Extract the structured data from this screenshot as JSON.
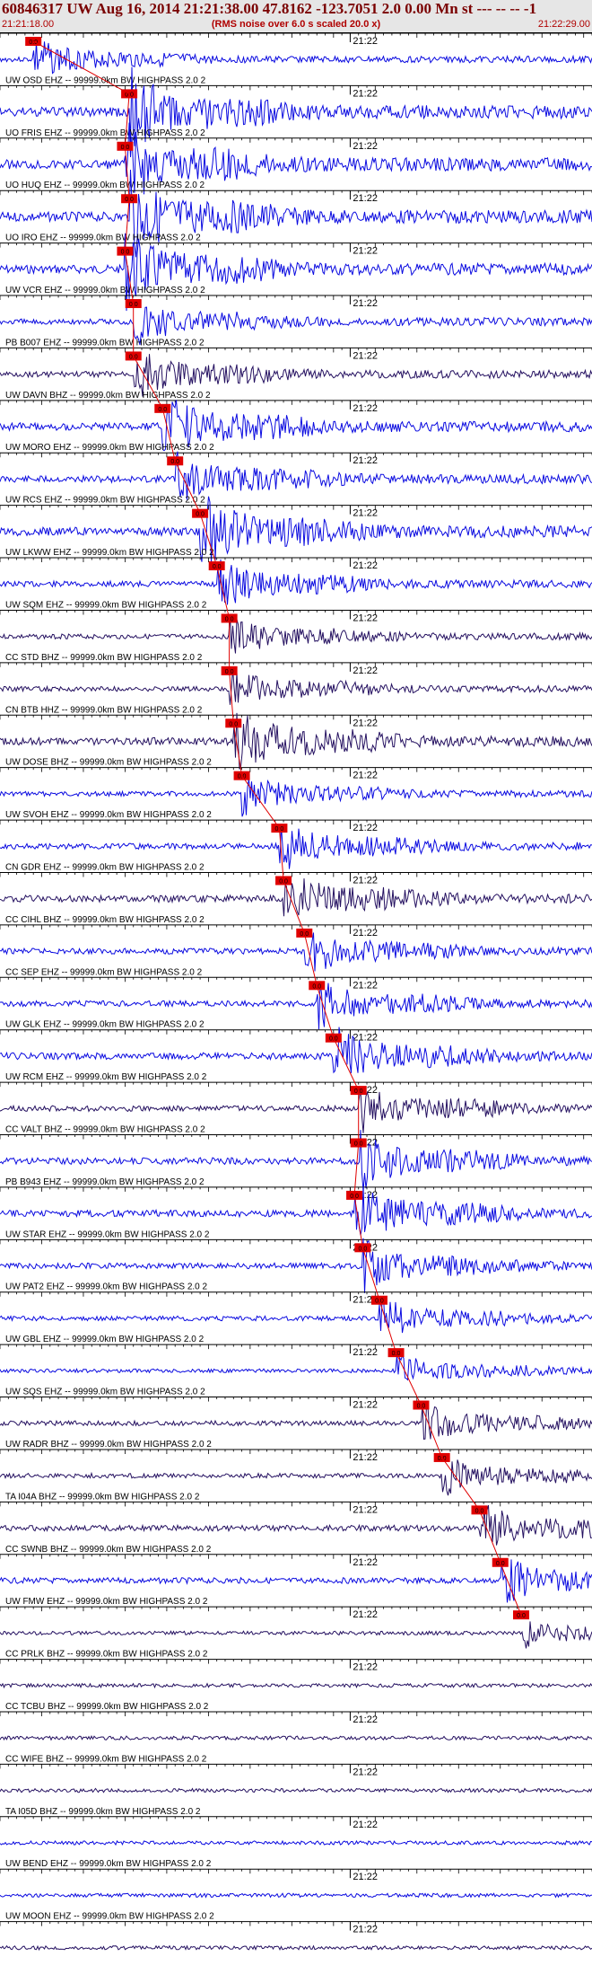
{
  "header": {
    "title": "60846317 UW Aug 16, 2014 21:21:38.00   47.8162 -123.7051  2.0 0.00 Mn st --- -- --   -1",
    "start_time": "21:21:18.00",
    "noise_note": "(RMS noise over 6.0 s scaled 20.0 x)",
    "end_time": "21:22:29.00"
  },
  "chart_data": {
    "type": "seismogram",
    "time_start": "21:21:18.00",
    "time_end": "21:22:29.00",
    "minute_label": "21:22",
    "minute_label_offset_s": 42,
    "pick_label": "0:0",
    "colors": {
      "trace_blue": "#0a0ae0",
      "trace_navy": "#241060",
      "pick": "#e00000",
      "text": "#000000"
    },
    "traces": [
      {
        "label": "UW OSD EHZ -- 99999.0km BW  HIGHPASS  2.0  2",
        "color": "blue",
        "pick_s": 4.0,
        "amp": 0.25
      },
      {
        "label": "UO FRIS EHZ -- 99999.0km BW  HIGHPASS  2.0  2",
        "color": "blue",
        "pick_s": 15.5,
        "amp": 0.5
      },
      {
        "label": "UO HUQ EHZ -- 99999.0km BW  HIGHPASS  2.0  2",
        "color": "blue",
        "pick_s": 15.0,
        "amp": 0.5
      },
      {
        "label": "UO IRO EHZ -- 99999.0km BW  HIGHPASS  2.0  2",
        "color": "blue",
        "pick_s": 15.5,
        "amp": 0.5
      },
      {
        "label": "UW VCR EHZ -- 99999.0km BW  HIGHPASS  2.0  2",
        "color": "blue",
        "pick_s": 15.0,
        "amp": 0.45
      },
      {
        "label": "PB B007 EHZ -- 99999.0km BW  HIGHPASS  2.0  2",
        "color": "blue",
        "pick_s": 16.0,
        "amp": 0.3
      },
      {
        "label": "UW DAVN BHZ -- 99999.0km BW  HIGHPASS  2.0  2",
        "color": "navy",
        "pick_s": 16.0,
        "amp": 0.3
      },
      {
        "label": "UW MORO EHZ -- 99999.0km BW  HIGHPASS  2.0  2",
        "color": "blue",
        "pick_s": 19.5,
        "amp": 0.4
      },
      {
        "label": "UW RCS EHZ -- 99999.0km BW  HIGHPASS  2.0  2",
        "color": "blue",
        "pick_s": 21.0,
        "amp": 0.35
      },
      {
        "label": "UW LKWW EHZ -- 99999.0km BW  HIGHPASS  2.0  2",
        "color": "blue",
        "pick_s": 24.0,
        "amp": 0.45
      },
      {
        "label": "UW SQM EHZ -- 99999.0km BW  HIGHPASS  2.0  2",
        "color": "blue",
        "pick_s": 26.0,
        "amp": 0.3
      },
      {
        "label": "CC STD BHZ -- 99999.0km BW  HIGHPASS  2.0  2",
        "color": "navy",
        "pick_s": 27.5,
        "amp": 0.25
      },
      {
        "label": "CN BTB HHZ -- 99999.0km BW  HIGHPASS  2.0  2",
        "color": "navy",
        "pick_s": 27.5,
        "amp": 0.25
      },
      {
        "label": "UW DOSE BHZ -- 99999.0km BW  HIGHPASS  2.0  2",
        "color": "navy",
        "pick_s": 28.0,
        "amp": 0.4
      },
      {
        "label": "UW SVOH EHZ -- 99999.0km BW  HIGHPASS  2.0  2",
        "color": "blue",
        "pick_s": 29.0,
        "amp": 0.25
      },
      {
        "label": "CN GDR EHZ -- 99999.0km BW  HIGHPASS  2.0  2",
        "color": "blue",
        "pick_s": 33.5,
        "amp": 0.3
      },
      {
        "label": "CC CIHL BHZ -- 99999.0km BW  HIGHPASS  2.0  2",
        "color": "navy",
        "pick_s": 34.0,
        "amp": 0.35
      },
      {
        "label": "CC SEP EHZ -- 99999.0km BW  HIGHPASS  2.0  2",
        "color": "blue",
        "pick_s": 36.5,
        "amp": 0.3
      },
      {
        "label": "UW GLK EHZ -- 99999.0km BW  HIGHPASS  2.0  2",
        "color": "blue",
        "pick_s": 38.0,
        "amp": 0.3
      },
      {
        "label": "UW RCM EHZ -- 99999.0km BW  HIGHPASS  2.0  2",
        "color": "blue",
        "pick_s": 40.0,
        "amp": 0.35
      },
      {
        "label": "CC VALT BHZ -- 99999.0km BW  HIGHPASS  2.0  2",
        "color": "navy",
        "pick_s": 43.0,
        "amp": 0.3
      },
      {
        "label": "PB B943 EHZ -- 99999.0km BW  HIGHPASS  2.0  2",
        "color": "blue",
        "pick_s": 43.0,
        "amp": 0.35
      },
      {
        "label": "UW STAR EHZ -- 99999.0km BW  HIGHPASS  2.0  2",
        "color": "blue",
        "pick_s": 42.5,
        "amp": 0.35
      },
      {
        "label": "UW PAT2 EHZ -- 99999.0km BW  HIGHPASS  2.0  2",
        "color": "blue",
        "pick_s": 43.5,
        "amp": 0.3
      },
      {
        "label": "UW GBL EHZ -- 99999.0km BW  HIGHPASS  2.0  2",
        "color": "blue",
        "pick_s": 45.5,
        "amp": 0.25
      },
      {
        "label": "UW SQS EHZ -- 99999.0km BW  HIGHPASS  2.0  2",
        "color": "blue",
        "pick_s": 47.5,
        "amp": 0.2
      },
      {
        "label": "UW RADR BHZ -- 99999.0km BW  HIGHPASS  2.0  2",
        "color": "navy",
        "pick_s": 50.5,
        "amp": 0.25
      },
      {
        "label": "TA I04A BHZ -- 99999.0km BW  HIGHPASS  2.0  2",
        "color": "navy",
        "pick_s": 53.0,
        "amp": 0.25
      },
      {
        "label": "CC SWNB BHZ -- 99999.0km BW  HIGHPASS  2.0  2",
        "color": "navy",
        "pick_s": 57.5,
        "amp": 0.3
      },
      {
        "label": "UW FMW EHZ -- 99999.0km BW  HIGHPASS  2.0  2",
        "color": "blue",
        "pick_s": 60.0,
        "amp": 0.3
      },
      {
        "label": "CC PRLK BHZ -- 99999.0km BW  HIGHPASS  2.0  2",
        "color": "navy",
        "pick_s": 62.5,
        "amp": 0.2
      },
      {
        "label": "CC TCBU BHZ -- 99999.0km BW  HIGHPASS  2.0  2",
        "color": "navy",
        "pick_s": null,
        "amp": 0.2
      },
      {
        "label": "CC WIFE BHZ -- 99999.0km BW  HIGHPASS  2.0  2",
        "color": "navy",
        "pick_s": null,
        "amp": 0.2
      },
      {
        "label": "TA I05D BHZ -- 99999.0km BW  HIGHPASS  2.0  2",
        "color": "navy",
        "pick_s": null,
        "amp": 0.2
      },
      {
        "label": "UW BEND EHZ -- 99999.0km BW  HIGHPASS  2.0  2",
        "color": "blue",
        "pick_s": null,
        "amp": 0.2
      },
      {
        "label": "UW MOON EHZ -- 99999.0km BW  HIGHPASS  2.0  2",
        "color": "blue",
        "pick_s": null,
        "amp": 0.2
      },
      {
        "label": "",
        "color": "navy",
        "pick_s": null,
        "amp": 0.2
      }
    ]
  }
}
